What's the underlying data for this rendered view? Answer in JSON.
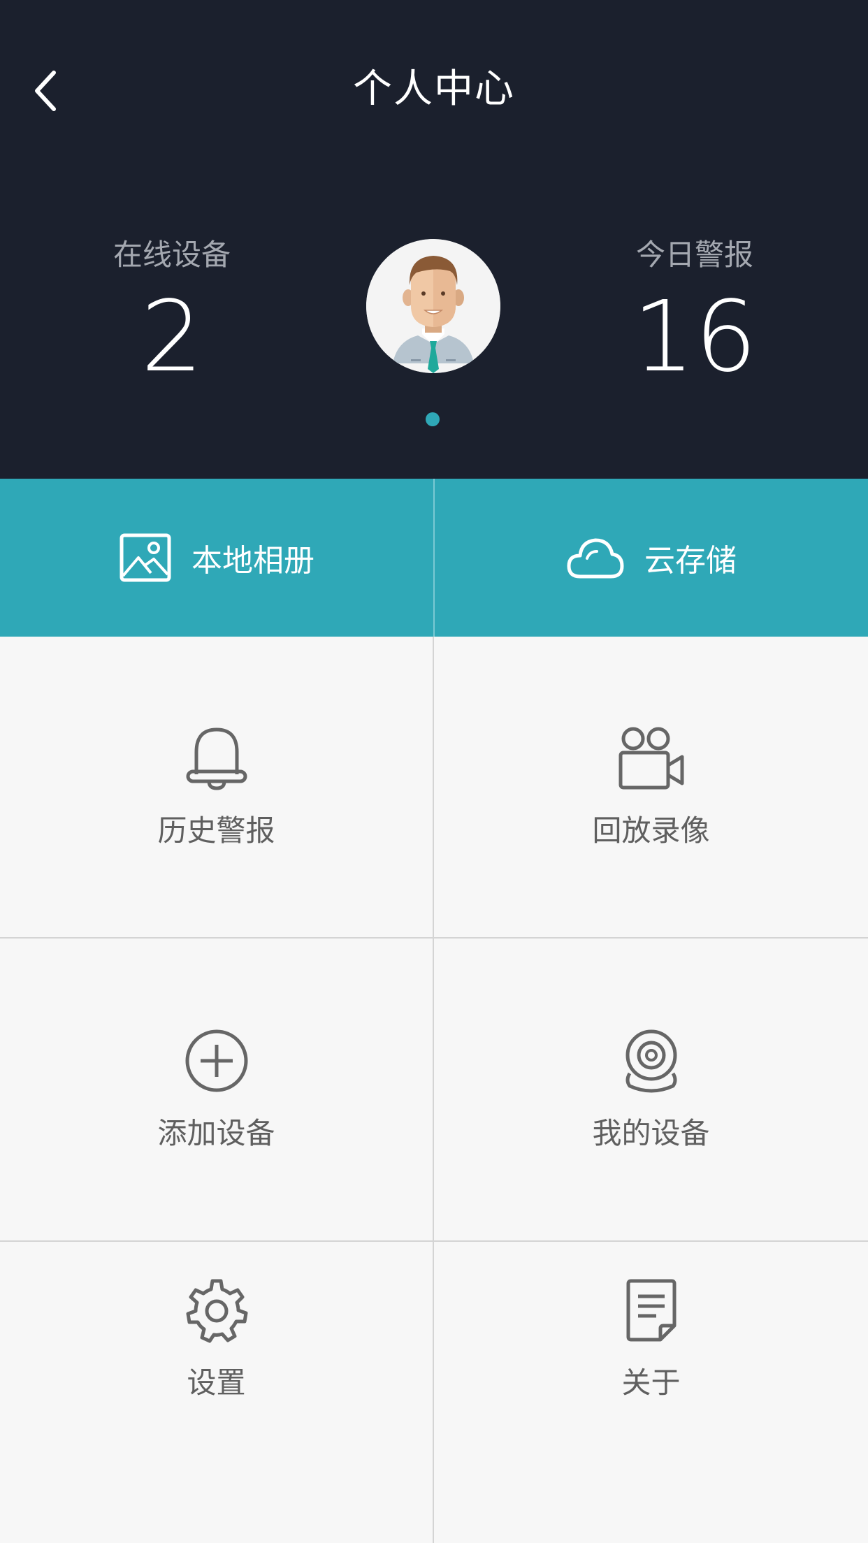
{
  "header": {
    "title": "个人中心",
    "online_devices": {
      "label": "在线设备",
      "value": "2"
    },
    "today_alerts": {
      "label": "今日警报",
      "value": "16"
    }
  },
  "quick_actions": [
    {
      "label": "本地相册",
      "icon": "photo-album-icon"
    },
    {
      "label": "云存储",
      "icon": "cloud-icon"
    }
  ],
  "menu": [
    {
      "label": "历史警报",
      "icon": "bell-icon"
    },
    {
      "label": "回放录像",
      "icon": "video-camera-icon"
    },
    {
      "label": "添加设备",
      "icon": "add-circle-icon"
    },
    {
      "label": "我的设备",
      "icon": "webcam-icon"
    },
    {
      "label": "设置",
      "icon": "gear-icon"
    },
    {
      "label": "关于",
      "icon": "document-icon"
    }
  ],
  "colors": {
    "header_bg": "#1b202d",
    "accent": "#2fa8b7",
    "grid_bg": "#f7f7f7",
    "icon_gray": "#666666"
  }
}
